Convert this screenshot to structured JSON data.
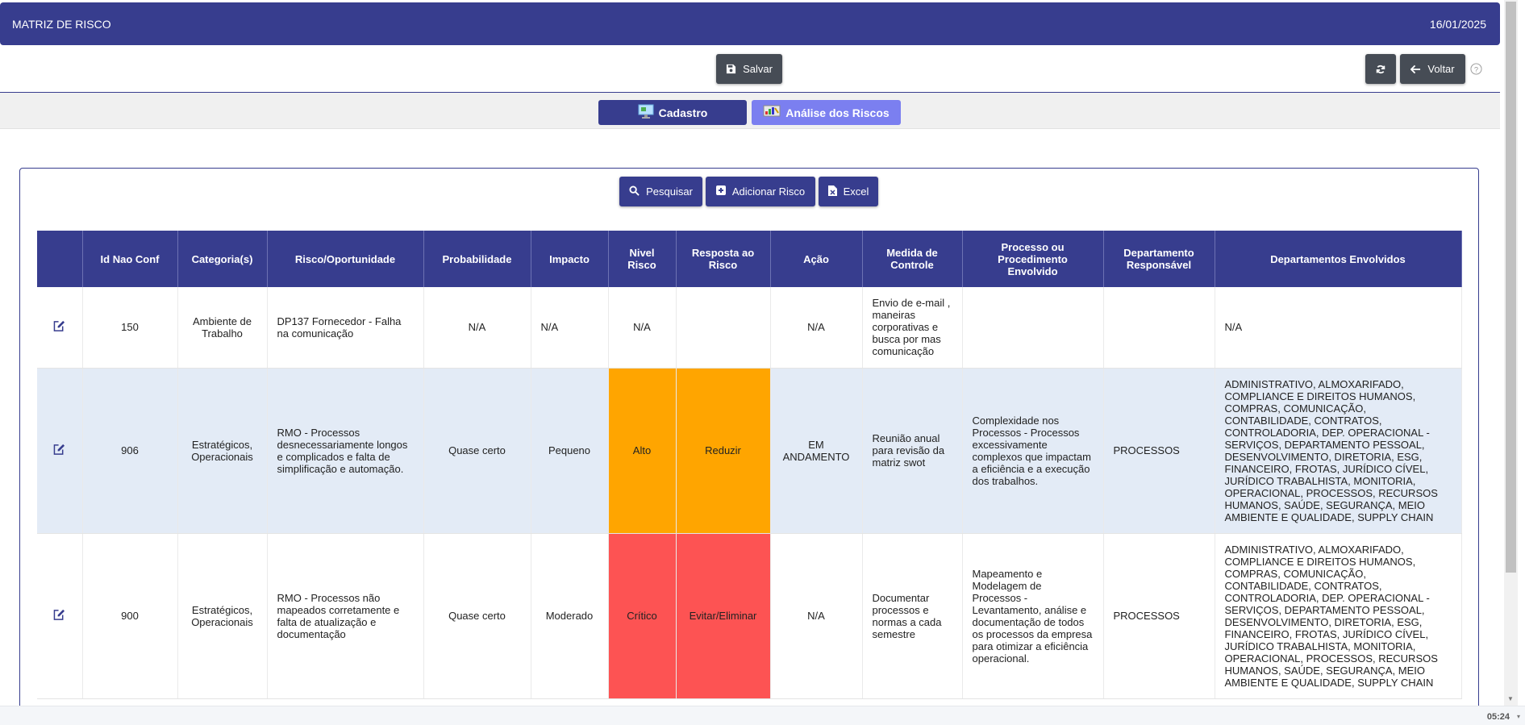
{
  "header": {
    "title": "MATRIZ DE RISCO",
    "date": "16/01/2025"
  },
  "toolbar": {
    "save_label": "Salvar",
    "back_label": "Voltar"
  },
  "tabs": [
    {
      "label": "Cadastro",
      "active": false
    },
    {
      "label": "Análise dos Riscos",
      "active": true
    }
  ],
  "actions": {
    "search_label": "Pesquisar",
    "add_label": "Adicionar Risco",
    "excel_label": "Excel"
  },
  "table": {
    "columns": [
      "",
      "Id Nao Conf",
      "Categoria(s)",
      "Risco/Oportunidade",
      "Probabilidade",
      "Impacto",
      "Nivel Risco",
      "Resposta ao Risco",
      "Ação",
      "Medida de Controle",
      "Processo ou Procedimento Envolvido",
      "Departamento Responsável",
      "Departamentos Envolvidos"
    ],
    "rows": [
      {
        "id": "150",
        "categoria": "Ambiente de Trabalho",
        "risco": "DP137 Fornecedor - Falha na comunicação",
        "probabilidade": "N/A",
        "impacto": "N/A",
        "nivel": "N/A",
        "resposta": "",
        "acao": "N/A",
        "medida": "Envio de e-mail , maneiras corporativas e busca por mas comunicação",
        "processo": "",
        "dep_responsavel": "",
        "dep_envolvidos": "N/A"
      },
      {
        "id": "906",
        "categoria": "Estratégicos, Operacionais",
        "risco": "RMO - Processos desnecessariamente longos e complicados e falta de simplificação e automação.",
        "probabilidade": "Quase certo",
        "impacto": "Pequeno",
        "nivel": "Alto",
        "resposta": "Reduzir",
        "acao": "EM ANDAMENTO",
        "medida": "Reunião anual para revisão da matriz swot",
        "processo": "Complexidade nos Processos - Processos excessivamente complexos que impactam a eficiência e a execução dos trabalhos.",
        "dep_responsavel": "PROCESSOS",
        "dep_envolvidos": "ADMINISTRATIVO, ALMOXARIFADO, COMPLIANCE E DIREITOS HUMANOS, COMPRAS, COMUNICAÇÃO, CONTABILIDADE, CONTRATOS, CONTROLADORIA, DEP. OPERACIONAL - SERVIÇOS, DEPARTAMENTO PESSOAL, DESENVOLVIMENTO, DIRETORIA, ESG, FINANCEIRO, FROTAS, JURÍDICO CÍVEL, JURÍDICO TRABALHISTA, MONITORIA, OPERACIONAL, PROCESSOS, RECURSOS HUMANOS, SAÚDE, SEGURANÇA, MEIO AMBIENTE E QUALIDADE, SUPPLY CHAIN"
      },
      {
        "id": "900",
        "categoria": "Estratégicos, Operacionais",
        "risco": "RMO - Processos não mapeados corretamente e falta de atualização e documentação",
        "probabilidade": "Quase certo",
        "impacto": "Moderado",
        "nivel": "Crítico",
        "resposta": "Evitar/Eliminar",
        "acao": "N/A",
        "medida": "Documentar processos e normas a cada semestre",
        "processo": "Mapeamento e Modelagem de Processos - Levantamento, análise e documentação de todos os processos da empresa para otimizar a eficiência operacional.",
        "dep_responsavel": "PROCESSOS",
        "dep_envolvidos": "ADMINISTRATIVO, ALMOXARIFADO, COMPLIANCE E DIREITOS HUMANOS, COMPRAS, COMUNICAÇÃO, CONTABILIDADE, CONTRATOS, CONTROLADORIA, DEP. OPERACIONAL - SERVIÇOS, DEPARTAMENTO PESSOAL, DESENVOLVIMENTO, DIRETORIA, ESG, FINANCEIRO, FROTAS, JURÍDICO CÍVEL, JURÍDICO TRABALHISTA, MONITORIA, OPERACIONAL, PROCESSOS, RECURSOS HUMANOS, SAÚDE, SEGURANÇA, MEIO AMBIENTE E QUALIDADE, SUPPLY CHAIN"
      }
    ]
  },
  "colors": {
    "primary": "#373d8e",
    "tab_active": "#7b7ff0",
    "dark_button": "#464c55",
    "level_alto": "#ffa500",
    "level_critico": "#fd5353",
    "row_alt": "#e3ebf6"
  },
  "taskbar": {
    "clock": "05:24"
  }
}
